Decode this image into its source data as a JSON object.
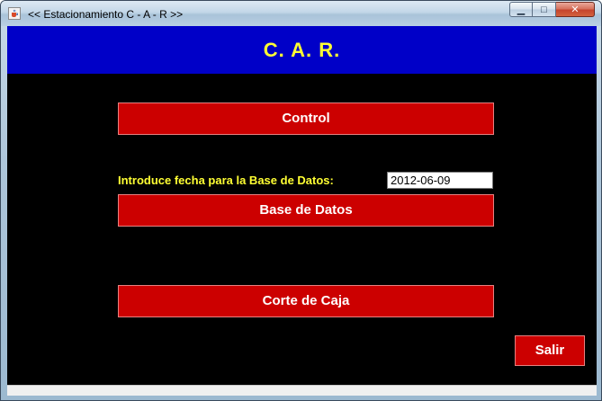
{
  "window": {
    "title": "<< Estacionamiento C - A - R >>",
    "app_icon": "java-cup-icon",
    "controls": {
      "minimize_glyph": "▁",
      "maximize_glyph": "□",
      "close_glyph": "✕"
    }
  },
  "header": {
    "title": "C. A. R."
  },
  "buttons": {
    "control": "Control",
    "base_de_datos": "Base de Datos",
    "corte_de_caja": "Corte de Caja",
    "salir": "Salir"
  },
  "fecha": {
    "label": "Introduce fecha para la Base de Datos:",
    "value": "2012-06-09"
  },
  "colors": {
    "header_bg": "#0000c8",
    "header_text": "#ffff33",
    "panel_bg": "#000000",
    "button_bg": "#cc0000",
    "button_text": "#ffffff",
    "label_text": "#ffff33"
  }
}
